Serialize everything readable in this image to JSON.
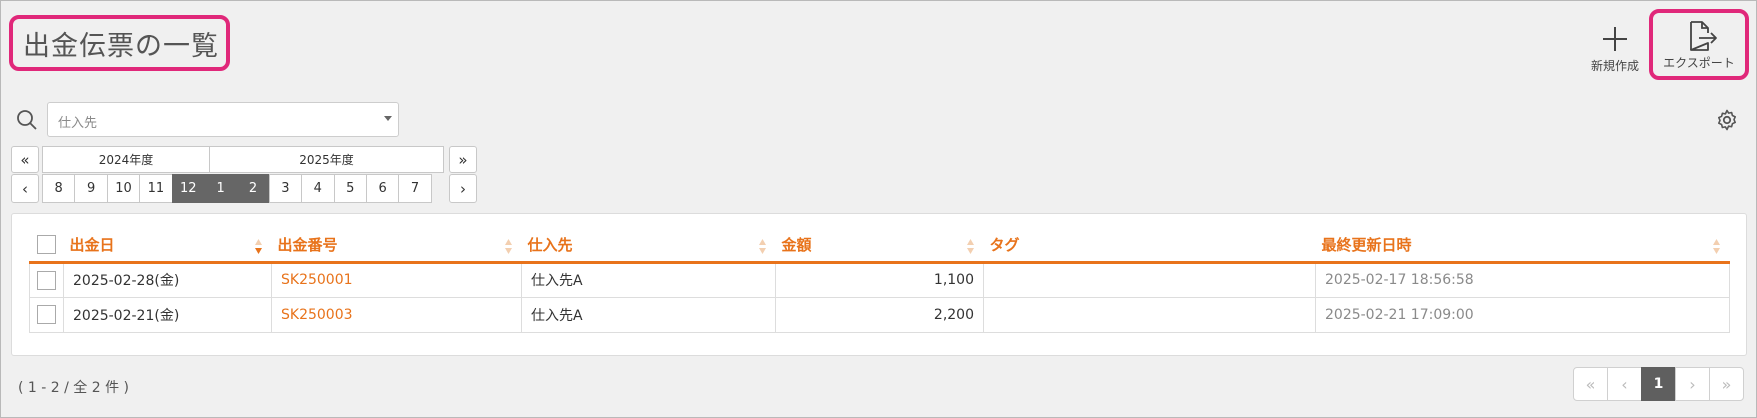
{
  "page": {
    "title": "出金伝票の一覧"
  },
  "actions": {
    "new_label": "新規作成",
    "export_label": "エクスポート",
    "new_icon": "plus-icon",
    "export_icon": "export-file-icon"
  },
  "search": {
    "placeholder": "仕入先",
    "icon": "search-icon"
  },
  "period": {
    "prev_year": "«",
    "next_year": "»",
    "prev_month": "‹",
    "next_month": "›",
    "years": [
      "2024年度",
      "2025年度"
    ],
    "months": [
      "8",
      "9",
      "10",
      "11",
      "12",
      "1",
      "2",
      "3",
      "4",
      "5",
      "6",
      "7"
    ],
    "selected_months": [
      "12",
      "1",
      "2"
    ]
  },
  "table": {
    "columns": [
      "出金日",
      "出金番号",
      "仕入先",
      "金額",
      "タグ",
      "最終更新日時"
    ],
    "rows": [
      {
        "date": "2025-02-28(金)",
        "number": "SK250001",
        "supplier": "仕入先A",
        "amount": "1,100",
        "tag": "",
        "updated": "2025-02-17 18:56:58"
      },
      {
        "date": "2025-02-21(金)",
        "number": "SK250003",
        "supplier": "仕入先A",
        "amount": "2,200",
        "tag": "",
        "updated": "2025-02-21 17:09:00"
      }
    ]
  },
  "footer": {
    "count_text": "( 1 - 2 / 全 2 件 )",
    "pager": {
      "first": "«",
      "prev": "‹",
      "current": "1",
      "next": "›",
      "last": "»"
    }
  },
  "colors": {
    "accent": "#e8731b",
    "highlight": "#e0287a",
    "selected": "#666666"
  }
}
